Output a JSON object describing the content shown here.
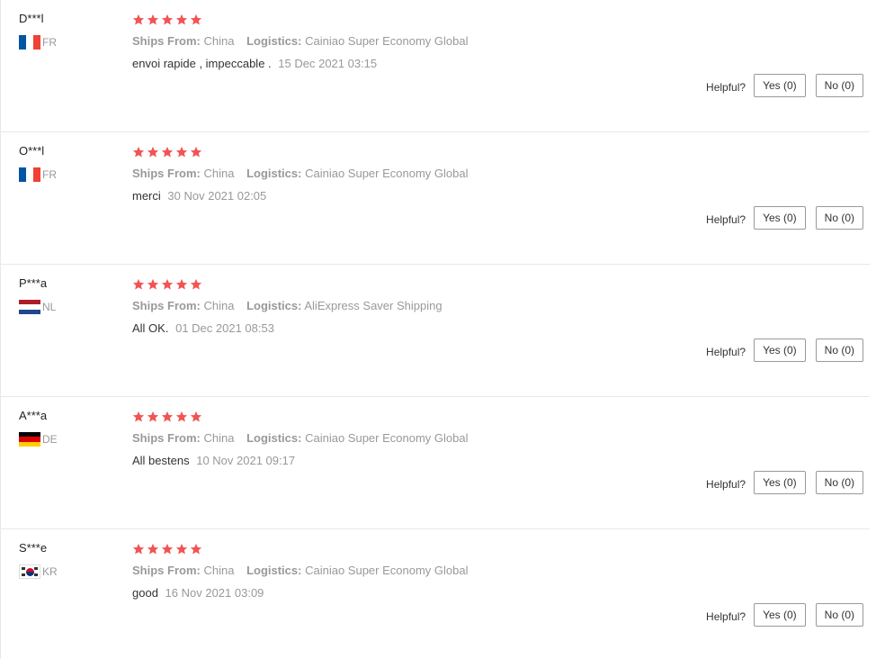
{
  "helpful_label": "Helpful?",
  "star_color": "#f25454",
  "reviews": [
    {
      "user": "D***l",
      "flag": "fr",
      "country": "FR",
      "stars": 5,
      "ships_from_label": "Ships From:",
      "ships_from": "China",
      "logistics_label": "Logistics:",
      "logistics": "Cainiao Super Economy Global",
      "text": "envoi rapide , impeccable .",
      "date": "15 Dec 2021 03:15",
      "yes_label": "Yes (0)",
      "no_label": "No (0)"
    },
    {
      "user": "O***l",
      "flag": "fr",
      "country": "FR",
      "stars": 5,
      "ships_from_label": "Ships From:",
      "ships_from": "China",
      "logistics_label": "Logistics:",
      "logistics": "Cainiao Super Economy Global",
      "text": "merci",
      "date": "30 Nov 2021 02:05",
      "yes_label": "Yes (0)",
      "no_label": "No (0)"
    },
    {
      "user": "P***a",
      "flag": "nl",
      "country": "NL",
      "stars": 5,
      "ships_from_label": "Ships From:",
      "ships_from": "China",
      "logistics_label": "Logistics:",
      "logistics": "AliExpress Saver Shipping",
      "text": "All OK.",
      "date": "01 Dec 2021 08:53",
      "yes_label": "Yes (0)",
      "no_label": "No (0)"
    },
    {
      "user": "A***a",
      "flag": "de",
      "country": "DE",
      "stars": 5,
      "ships_from_label": "Ships From:",
      "ships_from": "China",
      "logistics_label": "Logistics:",
      "logistics": "Cainiao Super Economy Global",
      "text": "All bestens",
      "date": "10 Nov 2021 09:17",
      "yes_label": "Yes (0)",
      "no_label": "No (0)"
    },
    {
      "user": "S***e",
      "flag": "kr",
      "country": "KR",
      "stars": 5,
      "ships_from_label": "Ships From:",
      "ships_from": "China",
      "logistics_label": "Logistics:",
      "logistics": "Cainiao Super Economy Global",
      "text": "good",
      "date": "16 Nov 2021 03:09",
      "yes_label": "Yes (0)",
      "no_label": "No (0)"
    }
  ]
}
